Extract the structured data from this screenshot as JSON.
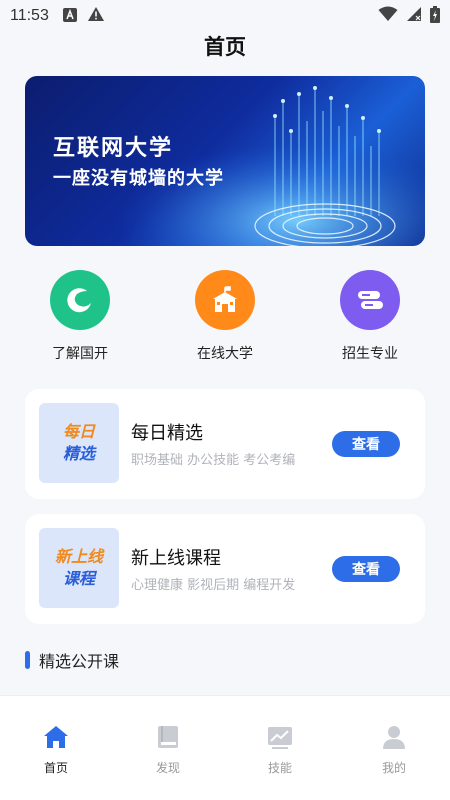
{
  "status_bar": {
    "time": "11:53"
  },
  "page_title": "首页",
  "banner": {
    "title": "互联网大学",
    "subtitle": "一座没有城墙的大学"
  },
  "quick_nav": [
    {
      "label": "了解国开",
      "icon": "leaf-logo-icon",
      "color": "#1fc389"
    },
    {
      "label": "在线大学",
      "icon": "school-building-icon",
      "color": "#ff8a1a"
    },
    {
      "label": "招生专业",
      "icon": "book-stack-icon",
      "color": "#7e5cf0"
    }
  ],
  "cards": [
    {
      "thumb_line1": "每日",
      "thumb_line2": "精选",
      "title": "每日精选",
      "subtitle": "职场基础 办公技能 考公考编",
      "button": "查看"
    },
    {
      "thumb_line1": "新上线",
      "thumb_line2": "课程",
      "title": "新上线课程",
      "subtitle": "心理健康 影视后期 编程开发",
      "button": "查看"
    }
  ],
  "section": {
    "title": "精选公开课"
  },
  "tab_bar": [
    {
      "label": "首页",
      "icon": "home-icon",
      "active": true
    },
    {
      "label": "发现",
      "icon": "book-icon",
      "active": false
    },
    {
      "label": "技能",
      "icon": "chart-icon",
      "active": false
    },
    {
      "label": "我的",
      "icon": "user-icon",
      "active": false
    }
  ],
  "colors": {
    "accent": "#2d6ee8",
    "background": "#f6f7fa"
  }
}
